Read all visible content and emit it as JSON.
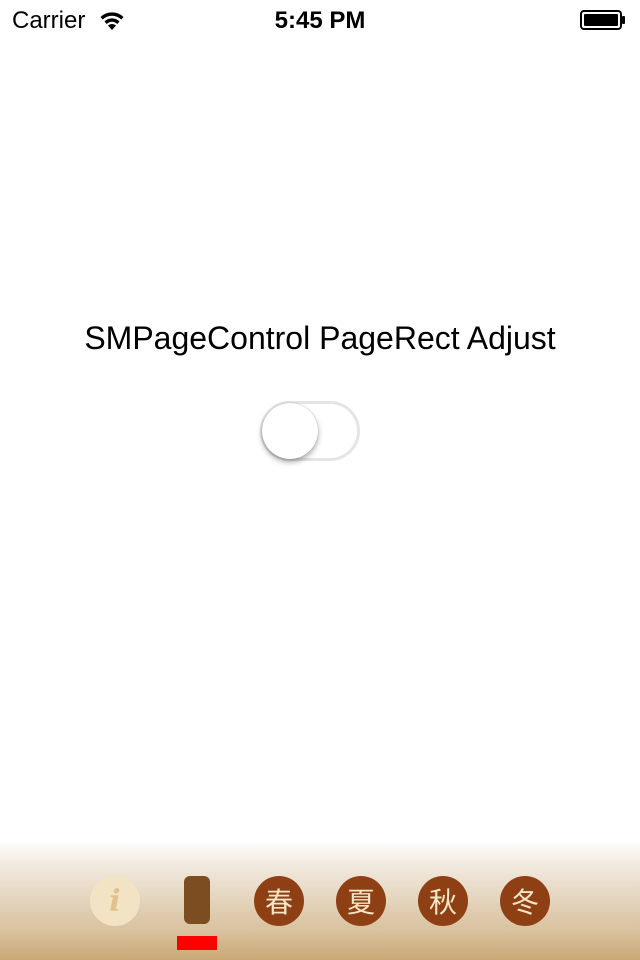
{
  "status_bar": {
    "carrier": "Carrier",
    "time": "5:45 PM",
    "wifi_icon": "wifi-icon",
    "battery_icon": "battery-full-icon"
  },
  "main": {
    "title": "SMPageControl PageRect Adjust",
    "toggle": {
      "state": "off",
      "track_color": "#e5e5e5",
      "knob_color": "#ffffff"
    }
  },
  "page_control": {
    "current_page_index": 1,
    "indicator_color": "#ff0000",
    "dot_color": "#8f3f14",
    "glyph_color": "#f6e6c6",
    "pages": [
      {
        "glyph": "i",
        "icon": "info-icon"
      },
      {
        "glyph": "",
        "icon": "current-page-bar"
      },
      {
        "glyph": "春"
      },
      {
        "glyph": "夏"
      },
      {
        "glyph": "秋"
      },
      {
        "glyph": "冬"
      }
    ]
  }
}
